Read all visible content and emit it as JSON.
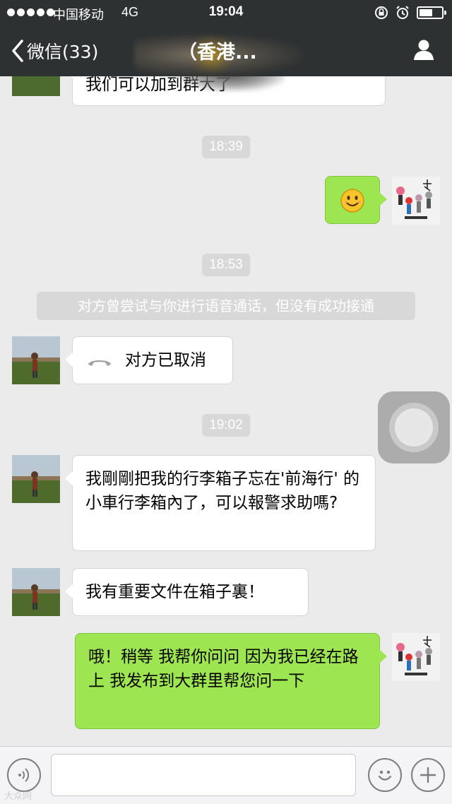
{
  "status_bar": {
    "carrier": "中国移动",
    "network": "4G",
    "time": "19:04"
  },
  "nav": {
    "back_label": "微信(33)",
    "chat_title": "（香港..."
  },
  "messages": [
    {
      "type": "text_in",
      "text": "我们可以加到群大了"
    },
    {
      "type": "timestamp",
      "text": "18:39"
    },
    {
      "type": "emoji_out",
      "emoji": "smile-emoji"
    },
    {
      "type": "timestamp",
      "text": "18:53"
    },
    {
      "type": "system",
      "text": "对方曾尝试与你进行语音通话，但没有成功接通"
    },
    {
      "type": "call_in",
      "text": "对方已取消",
      "icon": "phone-hangup-icon"
    },
    {
      "type": "timestamp",
      "text": "19:02"
    },
    {
      "type": "text_in",
      "text": "我剛剛把我的行李箱子忘在'前海行' 的小車行李箱內了，可以報警求助嗎?"
    },
    {
      "type": "text_in",
      "text": "我有重要文件在箱子裏！"
    },
    {
      "type": "text_out",
      "text": "哦！稍等  我帮你问问  因为我已经在路上  我发布到大群里帮您问一下"
    }
  ],
  "input_bar": {
    "placeholder": "",
    "voice_icon": "voice-icon",
    "emoji_icon": "emoji-icon",
    "plus_icon": "plus-icon"
  },
  "watermark": "大众网",
  "colors": {
    "nav_bg": "#2e3132",
    "chat_bg": "#ebebeb",
    "bubble_out": "#9ee651",
    "bubble_in": "#ffffff",
    "timestamp_bg": "#d8d8d8"
  }
}
